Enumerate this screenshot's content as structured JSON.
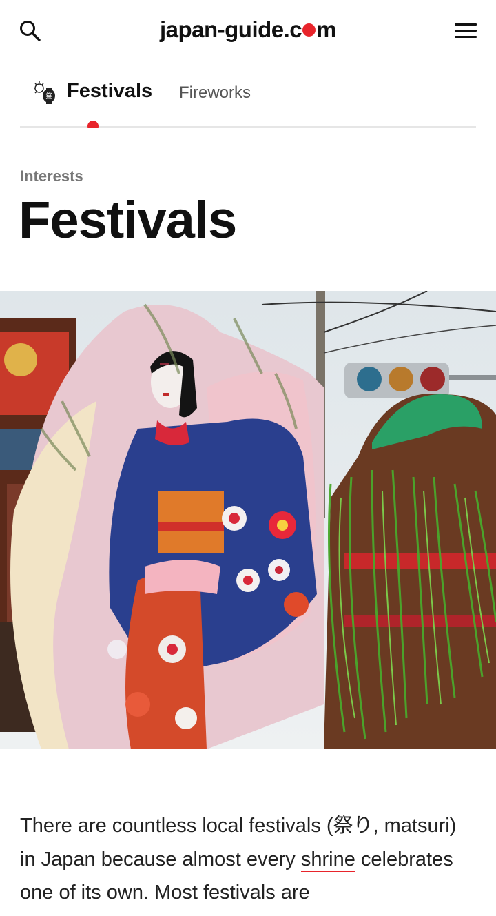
{
  "header": {
    "logo_pre": "japan-guide.c",
    "logo_post": "m",
    "search_icon": "search-icon",
    "menu_icon": "hamburger-menu-icon",
    "accent_color": "#e8242b"
  },
  "tabs": {
    "icon": "festival-lantern-icon",
    "active_label": "Festivals",
    "second_label": "Fireworks"
  },
  "breadcrumb": "Interests",
  "title": "Festivals",
  "hero": {
    "subject": "hero-photo"
  },
  "article": {
    "part1": "There are countless local festivals (祭り, matsuri) in Japan because almost every ",
    "link_text": "shrine",
    "part2": " celebrates one of its own. Most festivals are"
  }
}
